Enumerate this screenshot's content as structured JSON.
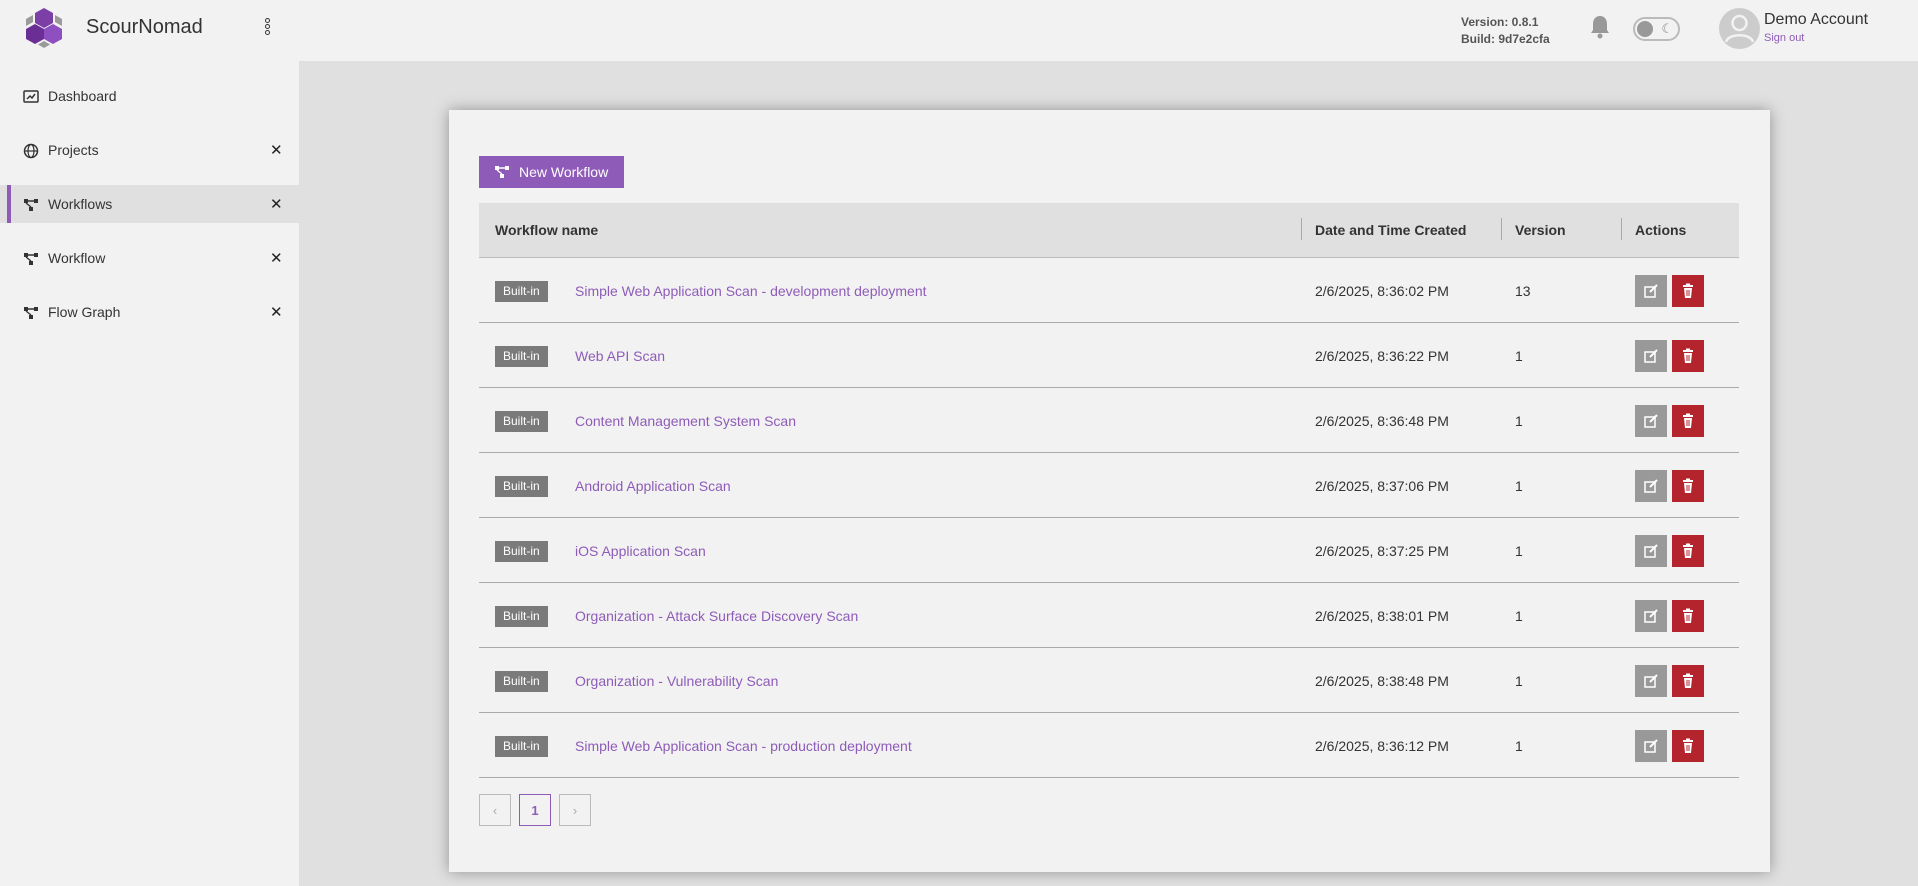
{
  "app": {
    "title": "ScourNomad"
  },
  "header": {
    "version": "Version: 0.8.1",
    "build": "Build: 9d7e2cfa",
    "account_name": "Demo Account",
    "sign_out": "Sign out"
  },
  "sidebar": {
    "items": [
      {
        "label": "Dashboard",
        "icon": "dashboard-icon",
        "closable": false,
        "active": false
      },
      {
        "label": "Projects",
        "icon": "globe-icon",
        "closable": true,
        "active": false
      },
      {
        "label": "Workflows",
        "icon": "workflow-icon",
        "closable": true,
        "active": true
      },
      {
        "label": "Workflow",
        "icon": "workflow-icon",
        "closable": true,
        "active": false
      },
      {
        "label": "Flow Graph",
        "icon": "workflow-icon",
        "closable": true,
        "active": false
      }
    ],
    "close_glyph": "✕"
  },
  "main": {
    "new_button": "New Workflow",
    "columns": {
      "name": "Workflow name",
      "date": "Date and Time Created",
      "version": "Version",
      "actions": "Actions"
    },
    "rows": [
      {
        "badge": "Built-in",
        "name": "Simple Web Application Scan - development deployment",
        "date": "2/6/2025, 8:36:02 PM",
        "version": "13"
      },
      {
        "badge": "Built-in",
        "name": "Web API Scan",
        "date": "2/6/2025, 8:36:22 PM",
        "version": "1"
      },
      {
        "badge": "Built-in",
        "name": "Content Management System Scan",
        "date": "2/6/2025, 8:36:48 PM",
        "version": "1"
      },
      {
        "badge": "Built-in",
        "name": "Android Application Scan",
        "date": "2/6/2025, 8:37:06 PM",
        "version": "1"
      },
      {
        "badge": "Built-in",
        "name": "iOS Application Scan",
        "date": "2/6/2025, 8:37:25 PM",
        "version": "1"
      },
      {
        "badge": "Built-in",
        "name": "Organization - Attack Surface Discovery Scan",
        "date": "2/6/2025, 8:38:01 PM",
        "version": "1"
      },
      {
        "badge": "Built-in",
        "name": "Organization - Vulnerability Scan",
        "date": "2/6/2025, 8:38:48 PM",
        "version": "1"
      },
      {
        "badge": "Built-in",
        "name": "Simple Web Application Scan - production deployment",
        "date": "2/6/2025, 8:36:12 PM",
        "version": "1"
      }
    ],
    "pagination": {
      "prev": "‹",
      "current": "1",
      "next": "›"
    }
  },
  "colors": {
    "accent": "#8e5cb8",
    "delete": "#b3242c",
    "badge": "#7a7a7a"
  }
}
